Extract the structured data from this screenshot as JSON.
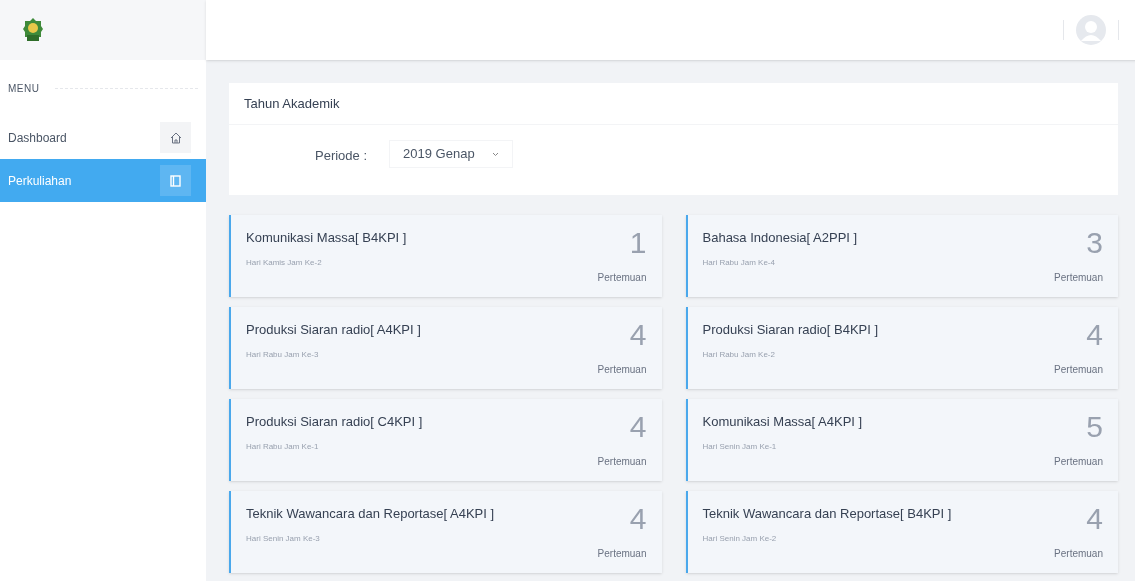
{
  "sidebar": {
    "menu_label": "MENU",
    "items": [
      {
        "label": "Dashboard",
        "selected": false
      },
      {
        "label": "Perkuliahan",
        "selected": true
      }
    ]
  },
  "academic_year": {
    "title": "Tahun Akademik",
    "period_label": "Periode :",
    "period_value": "2019 Genap"
  },
  "courses": [
    {
      "name": "Komunikasi Massa[ B4KPI ]",
      "schedule": "Hari Kamis Jam Ke-2",
      "count": "1",
      "count_label": "Pertemuan"
    },
    {
      "name": "Bahasa Indonesia[ A2PPI ]",
      "schedule": "Hari Rabu Jam Ke-4",
      "count": "3",
      "count_label": "Pertemuan"
    },
    {
      "name": "Produksi Siaran radio[ A4KPI ]",
      "schedule": "Hari Rabu Jam Ke-3",
      "count": "4",
      "count_label": "Pertemuan"
    },
    {
      "name": "Produksi Siaran radio[ B4KPI ]",
      "schedule": "Hari Rabu Jam Ke-2",
      "count": "4",
      "count_label": "Pertemuan"
    },
    {
      "name": "Produksi Siaran radio[ C4KPI ]",
      "schedule": "Hari Rabu Jam Ke-1",
      "count": "4",
      "count_label": "Pertemuan"
    },
    {
      "name": "Komunikasi Massa[ A4KPI ]",
      "schedule": "Hari Senin Jam Ke-1",
      "count": "5",
      "count_label": "Pertemuan"
    },
    {
      "name": "Teknik Wawancara dan Reportase[ A4KPI ]",
      "schedule": "Hari Senin Jam Ke-3",
      "count": "4",
      "count_label": "Pertemuan"
    },
    {
      "name": "Teknik Wawancara dan Reportase[ B4KPI ]",
      "schedule": "Hari Senin Jam Ke-2",
      "count": "4",
      "count_label": "Pertemuan"
    }
  ]
}
